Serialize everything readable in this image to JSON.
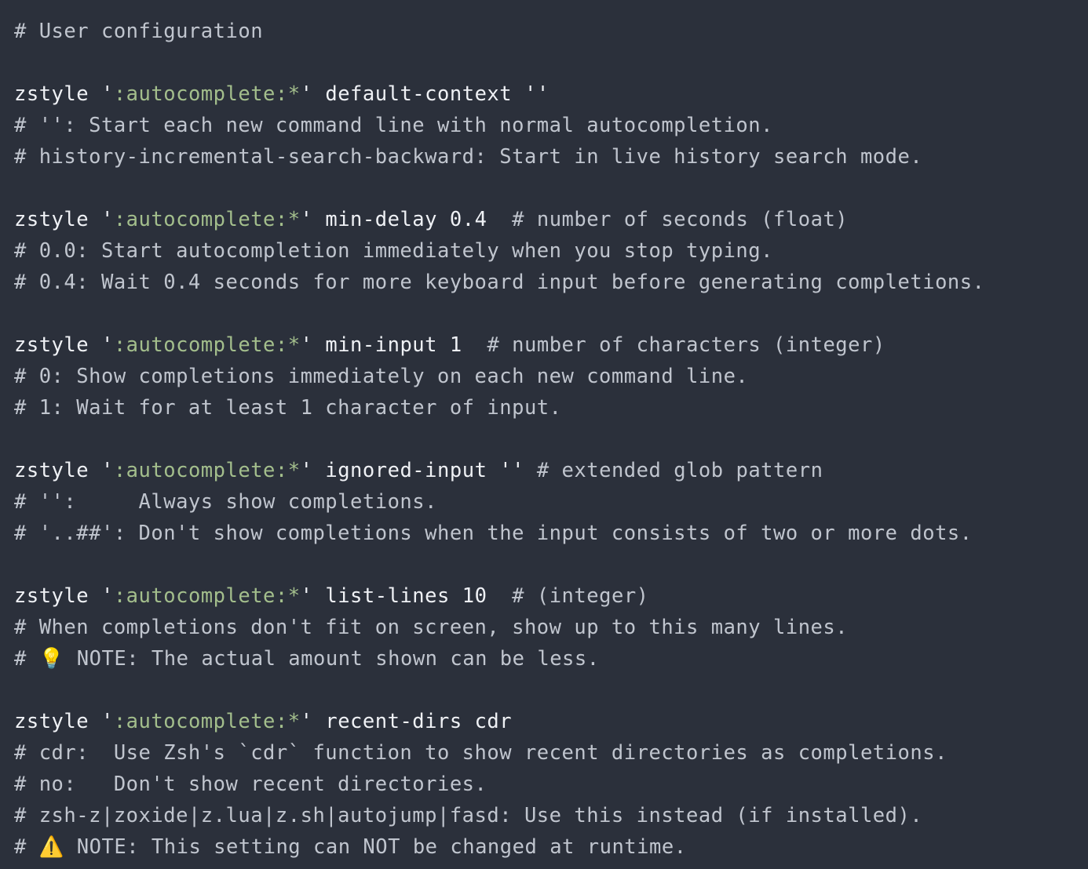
{
  "colors": {
    "background": "#2b303b",
    "text": "#c0c5ce",
    "keyword": "#eff1f5",
    "string": "#a3be8c"
  },
  "lines": [
    "# User configuration",
    "",
    "zstyle ':autocomplete:*' default-context ''",
    "# '': Start each new command line with normal autocompletion.",
    "# history-incremental-search-backward: Start in live history search mode.",
    "",
    "zstyle ':autocomplete:*' min-delay 0.4  # number of seconds (float)",
    "# 0.0: Start autocompletion immediately when you stop typing.",
    "# 0.4: Wait 0.4 seconds for more keyboard input before generating completions.",
    "",
    "zstyle ':autocomplete:*' min-input 1  # number of characters (integer)",
    "# 0: Show completions immediately on each new command line.",
    "# 1: Wait for at least 1 character of input.",
    "",
    "zstyle ':autocomplete:*' ignored-input '' # extended glob pattern",
    "# '':     Always show completions.",
    "# '..##': Don't show completions when the input consists of two or more dots.",
    "",
    "zstyle ':autocomplete:*' list-lines 10  # (integer)",
    "# When completions don't fit on screen, show up to this many lines.",
    "# 💡 NOTE: The actual amount shown can be less.",
    "",
    "zstyle ':autocomplete:*' recent-dirs cdr",
    "# cdr:  Use Zsh's `cdr` function to show recent directories as completions.",
    "# no:   Don't show recent directories.",
    "# zsh-z|zoxide|z.lua|z.sh|autojump|fasd: Use this instead (if installed).",
    "# ⚠️ NOTE: This setting can NOT be changed at runtime."
  ]
}
